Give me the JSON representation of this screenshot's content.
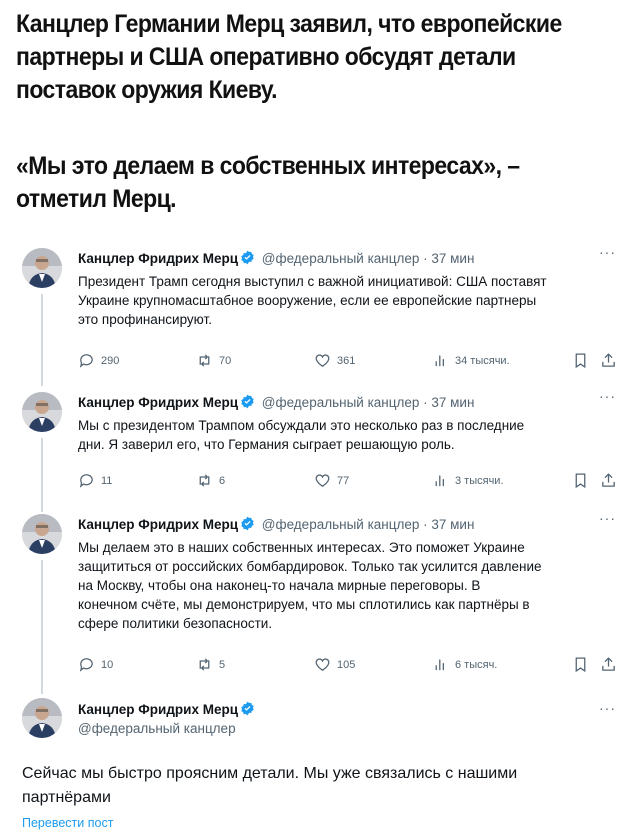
{
  "headline": {
    "line1": "Канцлер Германии Мерц заявил, что европейские\nпартнеры и США оперативно обсудят детали\nпоставок оружия Киеву.",
    "line2": "«Мы это делаем в собственных интересах», –\nотметил Мерц."
  },
  "tweets": [
    {
      "name": "Канцлер Фридрих Мерц",
      "meta": "@федеральный канцлер · 37 мин",
      "text": "Президент Трамп сегодня выступил с важной инициативой: США поставят\nУкраине крупномасштабное вооружение, если ее европейские партнеры\nэто профинансируют.",
      "replies": "290",
      "retweets": "70",
      "likes": "361",
      "views": "34 тысячи."
    },
    {
      "name": "Канцлер Фридрих Мерц",
      "meta": "@федеральный канцлер · 37 мин",
      "text": "Мы с президентом Трампом обсуждали это несколько раз в последние\nдни. Я заверил его, что Германия сыграет решающую роль.",
      "replies": "11",
      "retweets": "6",
      "likes": "77",
      "views": "3 тысячи."
    },
    {
      "name": "Канцлер Фридрих Мерц",
      "meta": "@федеральный канцлер · 37 мин",
      "text": "Мы делаем это в наших собственных интересах. Это поможет Украине\nзащититься от российских бомбардировок. Только так усилится давление\nна Москву, чтобы она наконец-то начала мирные переговоры. В\nконечном счёте, мы демонстрируем, что мы сплотились как партнёры в\nсфере политики безопасности.",
      "replies": "10",
      "retweets": "5",
      "likes": "105",
      "views": "6 тысяч."
    }
  ],
  "main_tweet": {
    "name": "Канцлер Фридрих Мерц",
    "handle": "@федеральный канцлер",
    "text": "Сейчас мы быстро проясним детали. Мы уже связались с нашими\nпартнёрами",
    "translate": "Перевести пост"
  },
  "more_label": "···",
  "colors": {
    "verified": "#1d9bf0",
    "muted": "#536471",
    "link": "#1d9bf0",
    "thread_line": "#cfd9de"
  }
}
